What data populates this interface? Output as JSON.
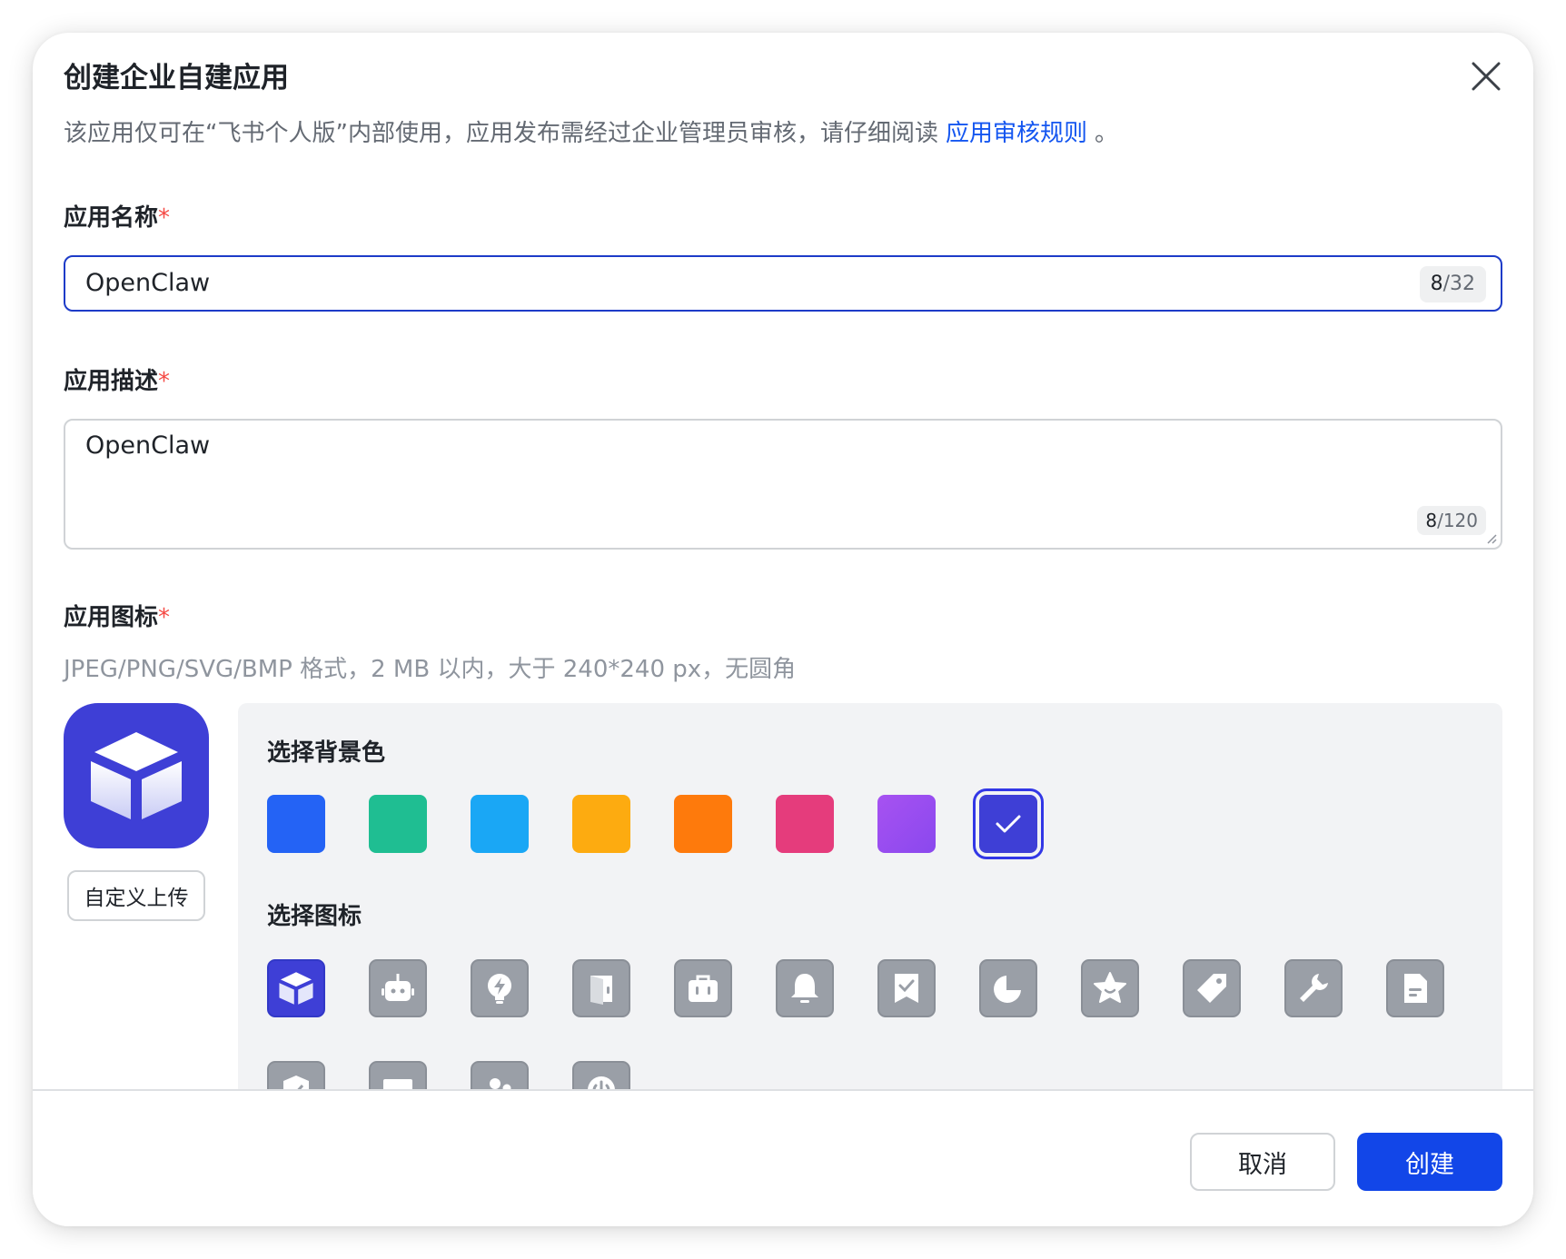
{
  "dialog": {
    "title": "创建企业自建应用",
    "subtitle": "该应用仅可在“飞书个人版”内部使用，应用发布需经过企业管理员审核，请仔细阅读",
    "subtitle_link": "应用审核规则",
    "subtitle_end": "。"
  },
  "form": {
    "name_label": "应用名称",
    "name_value": "OpenClaw",
    "name_count": "8",
    "name_max": "/32",
    "desc_label": "应用描述",
    "desc_value": "OpenClaw",
    "desc_count": "8",
    "desc_max": "/120",
    "required_mark": "*",
    "icon_label": "应用图标",
    "icon_hint": "JPEG/PNG/SVG/BMP 格式，2 MB 以内，大于 240*240 px，无圆角"
  },
  "upload": {
    "label": "自定义上传"
  },
  "picker": {
    "bg_title": "选择背景色",
    "icon_title": "选择图标",
    "colors": [
      "#2463f5",
      "#1fbe92",
      "#1aa7f5",
      "#fdab10",
      "#fe7a0c",
      "#e53c7c",
      "#9a4ff0",
      "#3e3fd6"
    ],
    "selected_color": "#3e3fd6",
    "icons": [
      "cube-icon",
      "robot-icon",
      "bulb-icon",
      "door-icon",
      "briefcase-icon",
      "bell-icon",
      "bookmark-check-icon",
      "pie-chart-icon",
      "star-icon",
      "tag-icon",
      "wrench-icon",
      "document-icon",
      "shield-check-icon",
      "card-icon",
      "people-icon",
      "power-icon"
    ],
    "selected_icon": "cube-icon"
  },
  "footer": {
    "cancel": "取消",
    "create": "创建"
  }
}
